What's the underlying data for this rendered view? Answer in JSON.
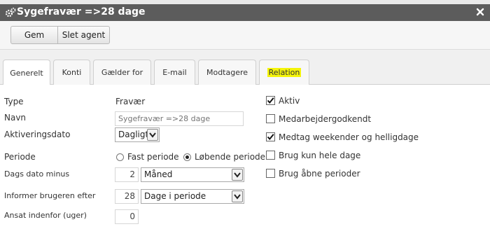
{
  "dialog": {
    "title": "Sygefravær =>28 dage"
  },
  "toolbar": {
    "save_label": "Gem",
    "delete_label": "Slet agent"
  },
  "tabs": [
    {
      "label": "Generelt",
      "active": true
    },
    {
      "label": "Konti"
    },
    {
      "label": "Gælder for"
    },
    {
      "label": "E-mail"
    },
    {
      "label": "Modtagere"
    },
    {
      "label": "Relation",
      "highlighted": true
    }
  ],
  "form": {
    "type": {
      "label": "Type",
      "value": "Fravær"
    },
    "navn": {
      "label": "Navn",
      "placeholder": "Sygefravær =>28 dage"
    },
    "aktiveringsdato": {
      "label": "Aktiveringsdato",
      "value": "Dagligt"
    },
    "periode": {
      "label": "Periode",
      "option_fast": "Fast periode",
      "option_lobende": "Løbende periode",
      "selected": "Løbende periode"
    },
    "dags_dato_minus": {
      "label": "Dags dato minus",
      "number": "2",
      "unit": "Måned"
    },
    "informer": {
      "label": "Informer brugeren efter",
      "number": "28",
      "unit": "Dage i periode"
    },
    "ansat": {
      "label": "Ansat indenfor (uger)",
      "number": "0"
    }
  },
  "checkboxes": [
    {
      "label": "Aktiv",
      "checked": true
    },
    {
      "label": "Medarbejdergodkendt",
      "checked": false
    },
    {
      "label": "Medtag weekender og helligdage",
      "checked": true
    },
    {
      "label": "Brug kun hele dage",
      "checked": false
    },
    {
      "label": "Brug åbne perioder",
      "checked": false
    }
  ],
  "colors": {
    "titlebar": "#5c5c5c",
    "highlight": "#f4f40a"
  }
}
